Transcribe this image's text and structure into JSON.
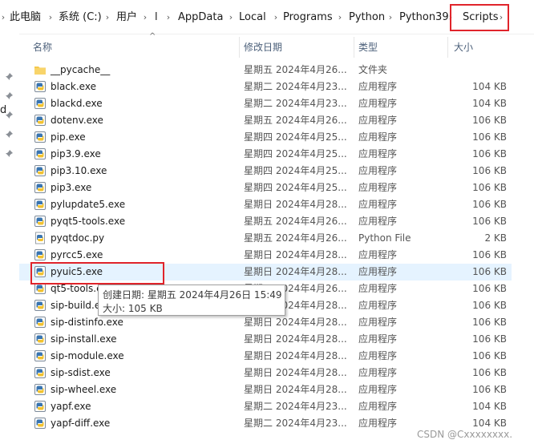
{
  "breadcrumb": [
    {
      "label": "此电脑"
    },
    {
      "label": "系统 (C:)"
    },
    {
      "label": "用户"
    },
    {
      "label": "l"
    },
    {
      "label": "AppData"
    },
    {
      "label": "Local"
    },
    {
      "label": "Programs"
    },
    {
      "label": "Python"
    },
    {
      "label": "Python39"
    },
    {
      "label": "Scripts"
    }
  ],
  "nav": {
    "partial_letter": "d"
  },
  "columns": {
    "name": "名称",
    "date": "修改日期",
    "type": "类型",
    "size": "大小"
  },
  "files": [
    {
      "name": "__pycache__",
      "date": "星期五  2024年4月26...",
      "type": "文件夹",
      "size": "",
      "icon": "folder-icon"
    },
    {
      "name": "black.exe",
      "date": "星期二  2024年4月23...",
      "type": "应用程序",
      "size": "104 KB",
      "icon": "python-exe-icon"
    },
    {
      "name": "blackd.exe",
      "date": "星期二  2024年4月23...",
      "type": "应用程序",
      "size": "104 KB",
      "icon": "python-exe-icon"
    },
    {
      "name": "dotenv.exe",
      "date": "星期五  2024年4月26...",
      "type": "应用程序",
      "size": "106 KB",
      "icon": "python-exe-icon"
    },
    {
      "name": "pip.exe",
      "date": "星期四  2024年4月25...",
      "type": "应用程序",
      "size": "106 KB",
      "icon": "python-exe-icon"
    },
    {
      "name": "pip3.9.exe",
      "date": "星期四  2024年4月25...",
      "type": "应用程序",
      "size": "106 KB",
      "icon": "python-exe-icon"
    },
    {
      "name": "pip3.10.exe",
      "date": "星期四  2024年4月25...",
      "type": "应用程序",
      "size": "106 KB",
      "icon": "python-exe-icon"
    },
    {
      "name": "pip3.exe",
      "date": "星期四  2024年4月25...",
      "type": "应用程序",
      "size": "106 KB",
      "icon": "python-exe-icon"
    },
    {
      "name": "pylupdate5.exe",
      "date": "星期日  2024年4月28...",
      "type": "应用程序",
      "size": "106 KB",
      "icon": "python-exe-icon"
    },
    {
      "name": "pyqt5-tools.exe",
      "date": "星期五  2024年4月26...",
      "type": "应用程序",
      "size": "106 KB",
      "icon": "python-exe-icon"
    },
    {
      "name": "pyqtdoc.py",
      "date": "星期五  2024年4月26...",
      "type": "Python File",
      "size": "2 KB",
      "icon": "python-file-icon"
    },
    {
      "name": "pyrcc5.exe",
      "date": "星期日  2024年4月28...",
      "type": "应用程序",
      "size": "106 KB",
      "icon": "python-exe-icon"
    },
    {
      "name": "pyuic5.exe",
      "date": "星期日  2024年4月28...",
      "type": "应用程序",
      "size": "106 KB",
      "icon": "python-exe-icon"
    },
    {
      "name": "qt5-tools.exe",
      "date": "星期五  2024年4月26...",
      "type": "应用程序",
      "size": "106 KB",
      "icon": "python-exe-icon"
    },
    {
      "name": "sip-build.exe",
      "date": "星期日  2024年4月28...",
      "type": "应用程序",
      "size": "106 KB",
      "icon": "python-exe-icon"
    },
    {
      "name": "sip-distinfo.exe",
      "date": "星期日  2024年4月28...",
      "type": "应用程序",
      "size": "106 KB",
      "icon": "python-exe-icon"
    },
    {
      "name": "sip-install.exe",
      "date": "星期日  2024年4月28...",
      "type": "应用程序",
      "size": "106 KB",
      "icon": "python-exe-icon"
    },
    {
      "name": "sip-module.exe",
      "date": "星期日  2024年4月28...",
      "type": "应用程序",
      "size": "106 KB",
      "icon": "python-exe-icon"
    },
    {
      "name": "sip-sdist.exe",
      "date": "星期日  2024年4月28...",
      "type": "应用程序",
      "size": "106 KB",
      "icon": "python-exe-icon"
    },
    {
      "name": "sip-wheel.exe",
      "date": "星期日  2024年4月28...",
      "type": "应用程序",
      "size": "106 KB",
      "icon": "python-exe-icon"
    },
    {
      "name": "yapf.exe",
      "date": "星期二  2024年4月23...",
      "type": "应用程序",
      "size": "104 KB",
      "icon": "python-exe-icon"
    },
    {
      "name": "yapf-diff.exe",
      "date": "星期二  2024年4月23...",
      "type": "应用程序",
      "size": "104 KB",
      "icon": "python-exe-icon"
    }
  ],
  "tooltip": {
    "created": "创建日期: 星期五  2024年4月26日 15:49",
    "size": "大小: 105 KB"
  },
  "watermark": "CSDN @Cxxxxxxxx.",
  "colors": {
    "highlight_border": "#e0242b",
    "selected_row": "#e5f3ff",
    "header_text": "#4c607a"
  }
}
